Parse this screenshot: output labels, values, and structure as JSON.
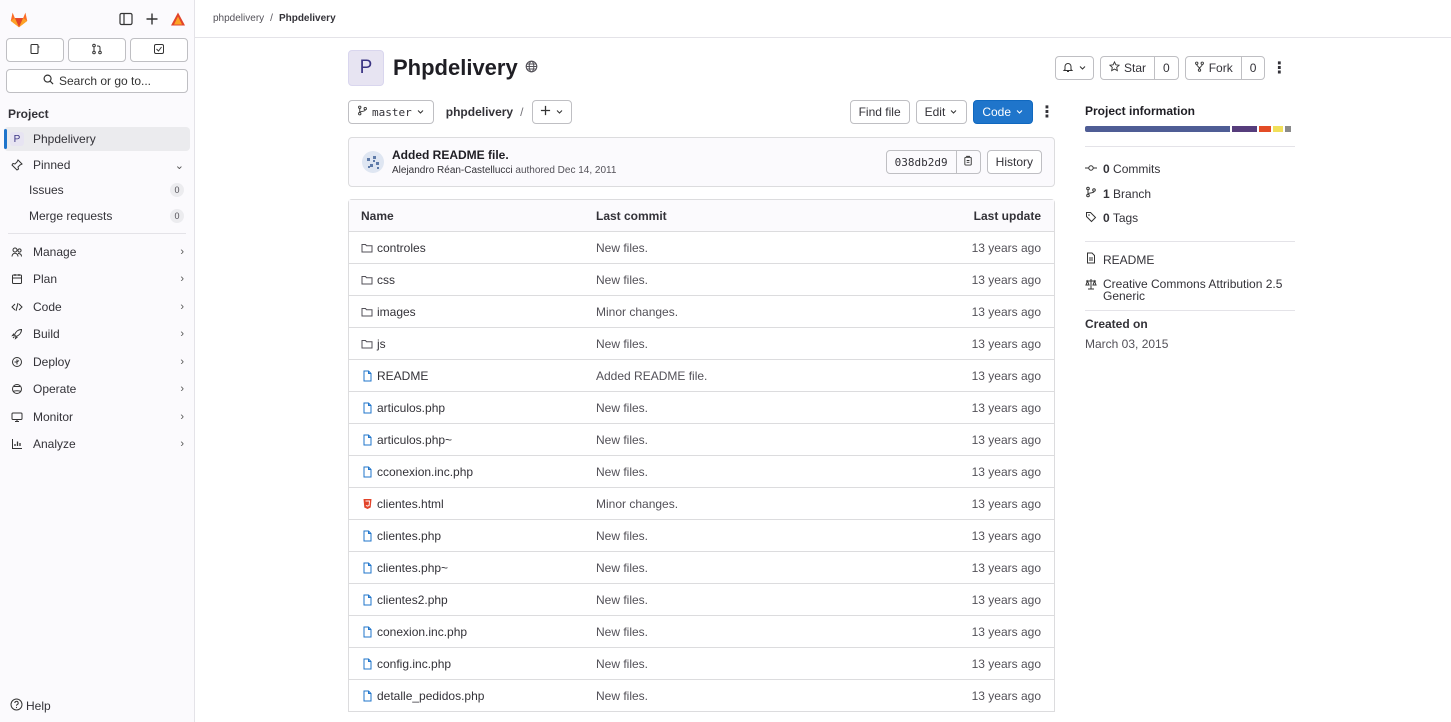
{
  "sidebar": {
    "search_label": "Search or go to...",
    "section_title": "Project",
    "project_item": {
      "avatar": "P",
      "label": "Phpdelivery"
    },
    "pinned_label": "Pinned",
    "pinned_items": [
      {
        "label": "Issues",
        "count": "0"
      },
      {
        "label": "Merge requests",
        "count": "0"
      }
    ],
    "nav": [
      {
        "label": "Manage",
        "icon": "users-icon"
      },
      {
        "label": "Plan",
        "icon": "plan-icon"
      },
      {
        "label": "Code",
        "icon": "code-icon"
      },
      {
        "label": "Build",
        "icon": "rocket-icon"
      },
      {
        "label": "Deploy",
        "icon": "deploy-icon"
      },
      {
        "label": "Operate",
        "icon": "operate-icon"
      },
      {
        "label": "Monitor",
        "icon": "monitor-icon"
      },
      {
        "label": "Analyze",
        "icon": "chart-icon"
      }
    ],
    "help_label": "Help"
  },
  "breadcrumb": {
    "parent": "phpdelivery",
    "current": "Phpdelivery"
  },
  "project": {
    "avatar": "P",
    "title": "Phpdelivery",
    "star_label": "Star",
    "star_count": "0",
    "fork_label": "Fork",
    "fork_count": "0"
  },
  "toolbar": {
    "branch": "master",
    "path": "phpdelivery",
    "path_sep": "/",
    "find_file": "Find file",
    "edit": "Edit",
    "code": "Code"
  },
  "commit": {
    "message": "Added README file.",
    "author": "Alejandro Réan-Castellucci",
    "action": "authored",
    "date": "Dec 14, 2011",
    "sha": "038db2d9",
    "history": "History"
  },
  "tree": {
    "headers": {
      "name": "Name",
      "commit": "Last commit",
      "update": "Last update"
    },
    "rows": [
      {
        "name": "controles",
        "type": "folder",
        "commit": "New files.",
        "updated": "13 years ago"
      },
      {
        "name": "css",
        "type": "folder",
        "commit": "New files.",
        "updated": "13 years ago"
      },
      {
        "name": "images",
        "type": "folder",
        "commit": "Minor changes.",
        "updated": "13 years ago"
      },
      {
        "name": "js",
        "type": "folder",
        "commit": "New files.",
        "updated": "13 years ago"
      },
      {
        "name": "README",
        "type": "file",
        "commit": "Added README file.",
        "updated": "13 years ago"
      },
      {
        "name": "articulos.php",
        "type": "file",
        "commit": "New files.",
        "updated": "13 years ago"
      },
      {
        "name": "articulos.php~",
        "type": "file",
        "commit": "New files.",
        "updated": "13 years ago"
      },
      {
        "name": "cconexion.inc.php",
        "type": "file",
        "commit": "New files.",
        "updated": "13 years ago"
      },
      {
        "name": "clientes.html",
        "type": "html",
        "commit": "Minor changes.",
        "updated": "13 years ago"
      },
      {
        "name": "clientes.php",
        "type": "file",
        "commit": "New files.",
        "updated": "13 years ago"
      },
      {
        "name": "clientes.php~",
        "type": "file",
        "commit": "New files.",
        "updated": "13 years ago"
      },
      {
        "name": "clientes2.php",
        "type": "file",
        "commit": "New files.",
        "updated": "13 years ago"
      },
      {
        "name": "conexion.inc.php",
        "type": "file",
        "commit": "New files.",
        "updated": "13 years ago"
      },
      {
        "name": "config.inc.php",
        "type": "file",
        "commit": "New files.",
        "updated": "13 years ago"
      },
      {
        "name": "detalle_pedidos.php",
        "type": "file",
        "commit": "New files.",
        "updated": "13 years ago"
      }
    ]
  },
  "info": {
    "title": "Project information",
    "languages": [
      {
        "color": "#4f5d95",
        "share": 0.72
      },
      {
        "color": "#563d7c",
        "share": 0.12
      },
      {
        "color": "#e34c26",
        "share": 0.06
      },
      {
        "color": "#f1e05a",
        "share": 0.05
      },
      {
        "color": "#8a8a8a",
        "share": 0.03
      }
    ],
    "commits_count": "0",
    "commits_label": "Commits",
    "branch_count": "1",
    "branch_label": "Branch",
    "tags_count": "0",
    "tags_label": "Tags",
    "readme": "README",
    "license": "Creative Commons Attribution 2.5 Generic",
    "created_title": "Created on",
    "created_value": "March 03, 2015"
  },
  "colors": {
    "accent": "#1f75cb",
    "folder": "#535158",
    "file": "#1f75cb",
    "html": "#e24329"
  }
}
